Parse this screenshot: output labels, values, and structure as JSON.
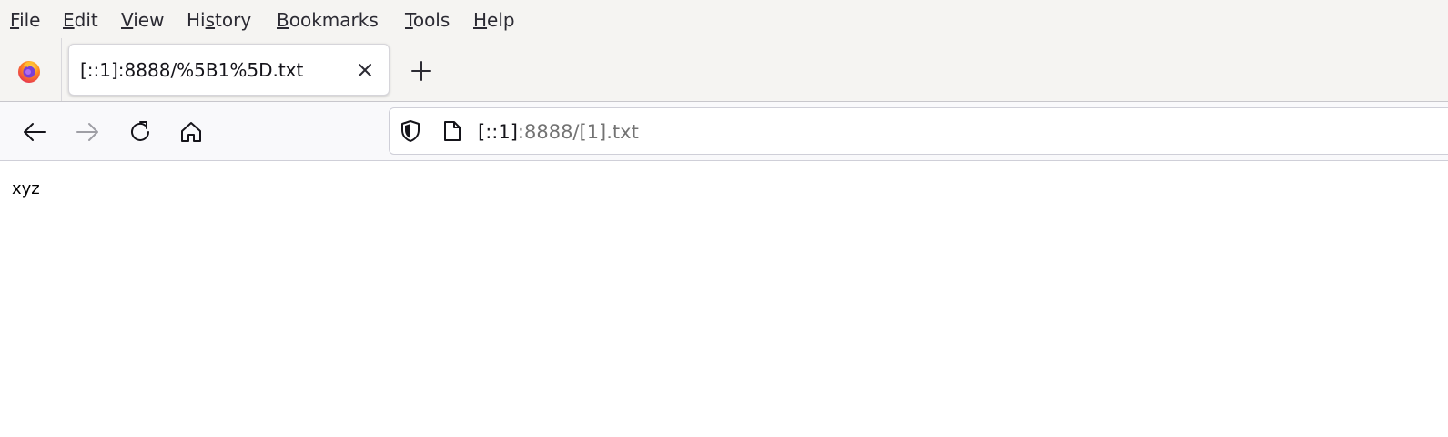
{
  "menu": {
    "items": [
      {
        "pre": "",
        "u": "F",
        "post": "ile"
      },
      {
        "pre": "",
        "u": "E",
        "post": "dit"
      },
      {
        "pre": "",
        "u": "V",
        "post": "iew"
      },
      {
        "pre": "Hi",
        "u": "s",
        "post": "tory"
      },
      {
        "pre": "",
        "u": "B",
        "post": "ookmarks"
      },
      {
        "pre": "",
        "u": "T",
        "post": "ools"
      },
      {
        "pre": "",
        "u": "H",
        "post": "elp"
      }
    ]
  },
  "tabs": {
    "active_title": "[::1]:8888/%5B1%5D.txt"
  },
  "urlbar": {
    "host": "[::1]",
    "rest": ":8888/[1].txt"
  },
  "content": {
    "text": "xyz"
  },
  "icons": {
    "app": "firefox-icon",
    "tab_close": "close-icon",
    "new_tab": "plus-icon",
    "back": "arrow-left-icon",
    "forward": "arrow-right-icon",
    "reload": "reload-icon",
    "home": "home-icon",
    "tracking": "shield-icon",
    "page": "page-icon"
  },
  "colors": {
    "chrome_bg": "#f5f4f2",
    "toolbar_bg": "#f9f9fb",
    "text": "#15141a",
    "muted": "#737373"
  }
}
